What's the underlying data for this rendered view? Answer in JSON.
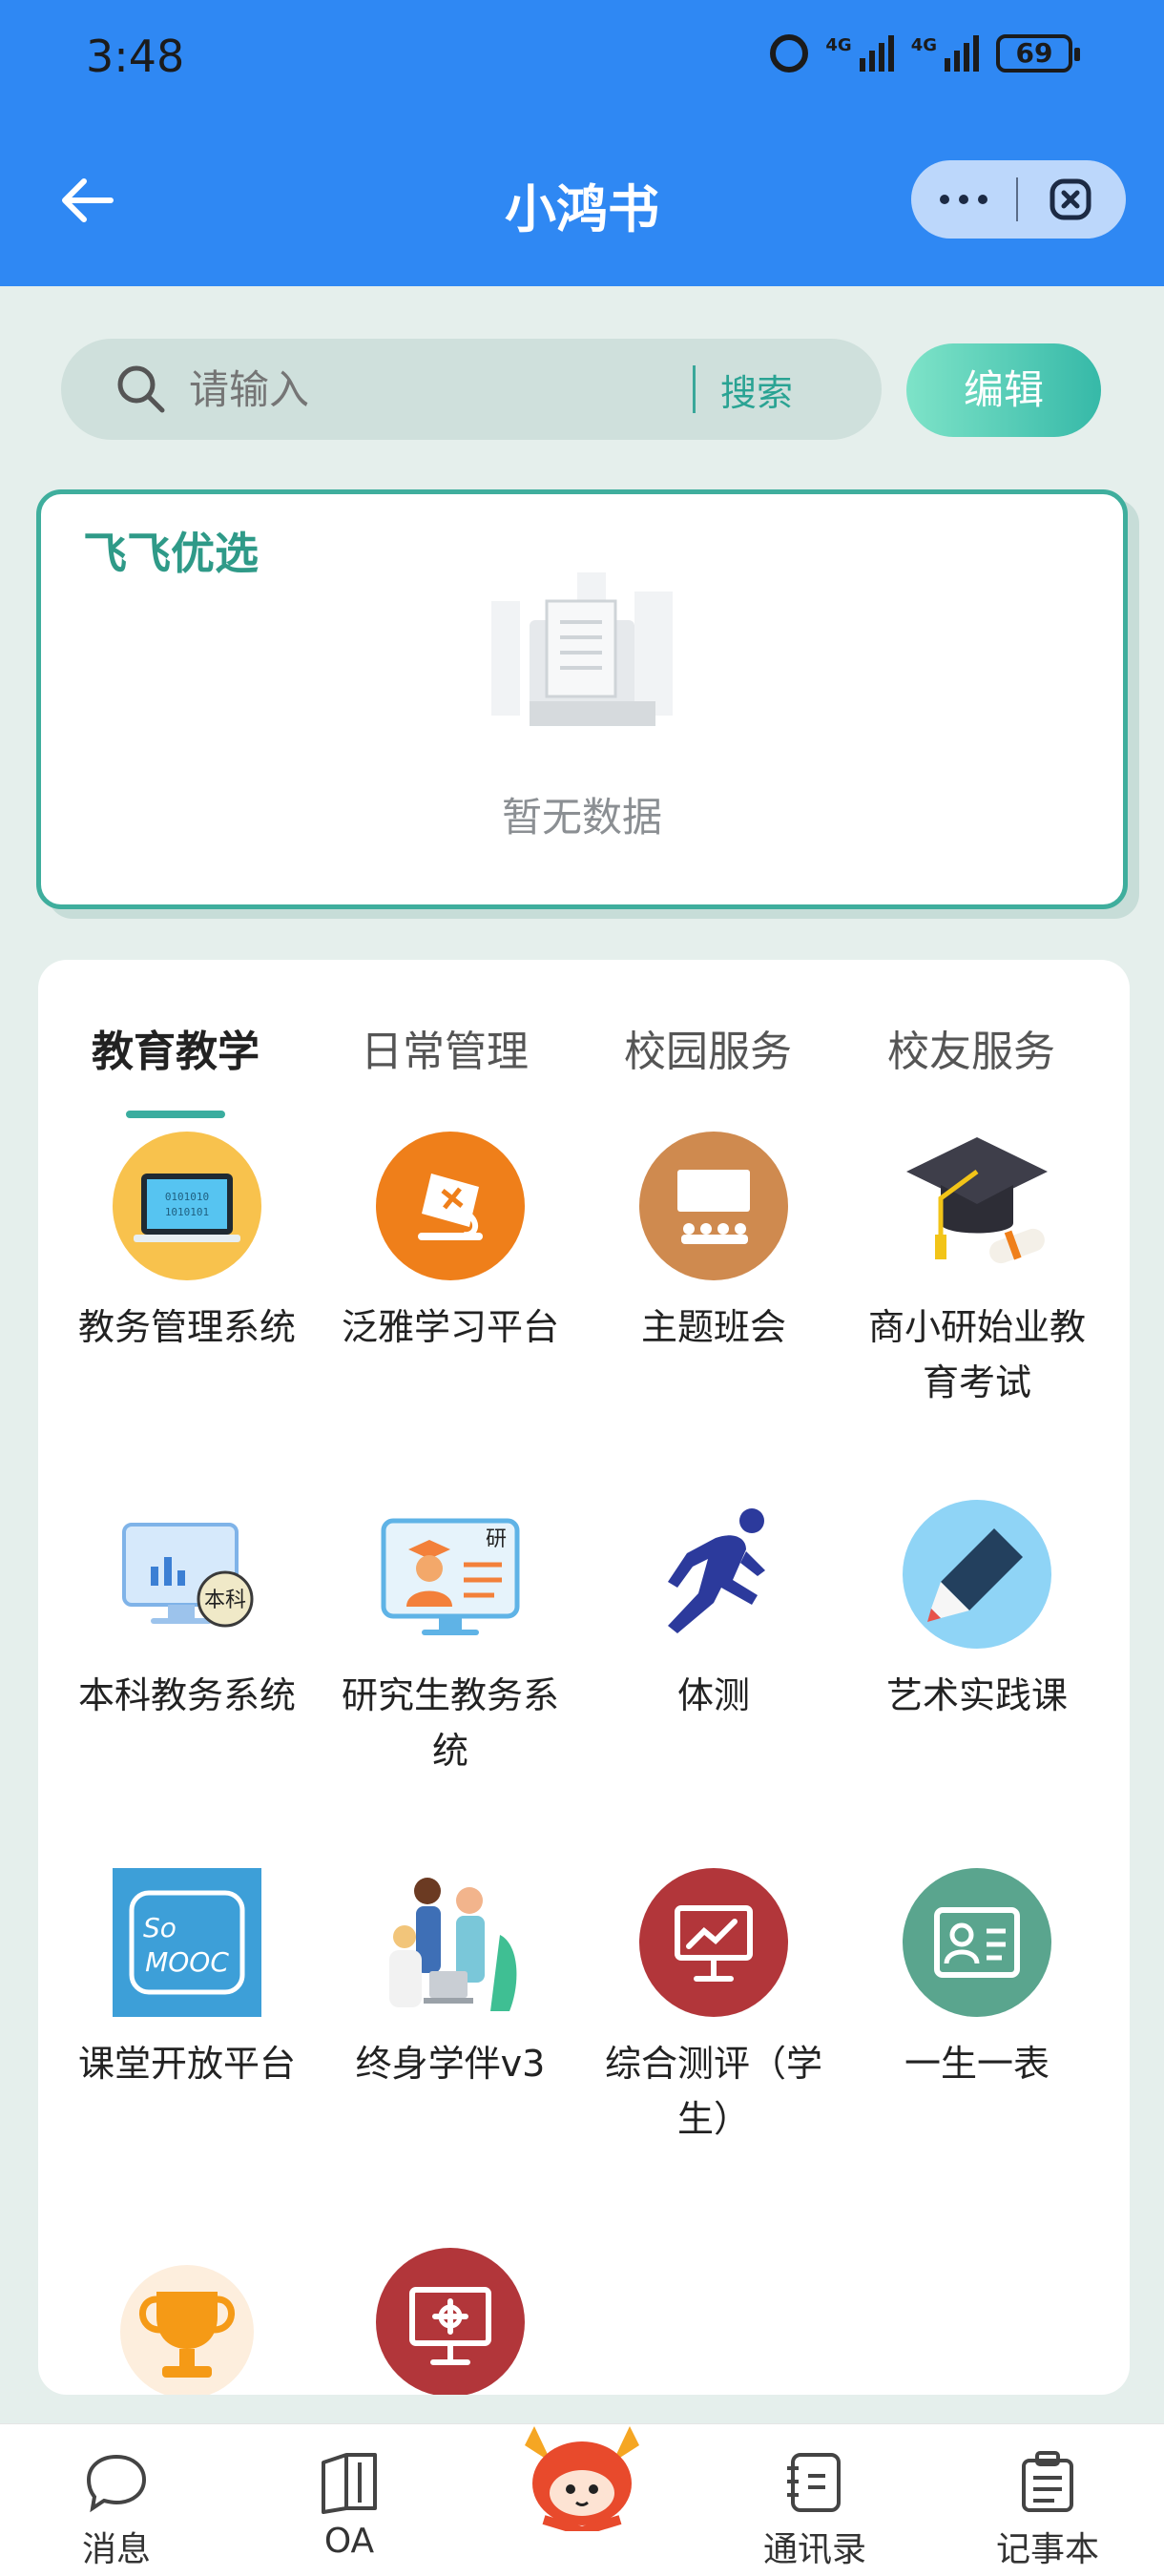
{
  "status": {
    "time": "3:48",
    "network1": "4G",
    "network2": "4G",
    "battery": "69"
  },
  "appbar": {
    "title": "小鸿书"
  },
  "search": {
    "placeholder": "请输入",
    "button": "搜索"
  },
  "edit_label": "编辑",
  "featured": {
    "title": "飞飞优选",
    "empty_text": "暂无数据"
  },
  "tabs": [
    {
      "label": "教育教学"
    },
    {
      "label": "日常管理"
    },
    {
      "label": "校园服务"
    },
    {
      "label": "校友服务"
    }
  ],
  "apps": [
    {
      "label": "教务管理系统",
      "icon": "laptop-icon"
    },
    {
      "label": "泛雅学习平台",
      "icon": "fanya-icon"
    },
    {
      "label": "主题班会",
      "icon": "classroom-icon"
    },
    {
      "label": "商小研始业教育考试",
      "icon": "graduation-cap-icon"
    },
    {
      "label": "本科教务系统",
      "icon": "monitor-chart-icon"
    },
    {
      "label": "研究生教务系统",
      "icon": "graduate-monitor-icon"
    },
    {
      "label": "体测",
      "icon": "runner-icon"
    },
    {
      "label": "艺术实践课",
      "icon": "marker-icon"
    },
    {
      "label": "课堂开放平台",
      "icon": "mooc-icon"
    },
    {
      "label": "终身学伴v3",
      "icon": "people-icon"
    },
    {
      "label": "综合测评（学生）",
      "icon": "chart-board-icon"
    },
    {
      "label": "一生一表",
      "icon": "id-card-icon"
    },
    {
      "label": "",
      "icon": "trophy-icon"
    },
    {
      "label": "",
      "icon": "presentation-icon"
    }
  ],
  "nav": [
    {
      "label": "消息",
      "icon": "chat-icon"
    },
    {
      "label": "OA",
      "icon": "book-icon"
    },
    {
      "label": "",
      "icon": "mascot-icon"
    },
    {
      "label": "通讯录",
      "icon": "contacts-icon"
    },
    {
      "label": "记事本",
      "icon": "notepad-icon"
    }
  ]
}
